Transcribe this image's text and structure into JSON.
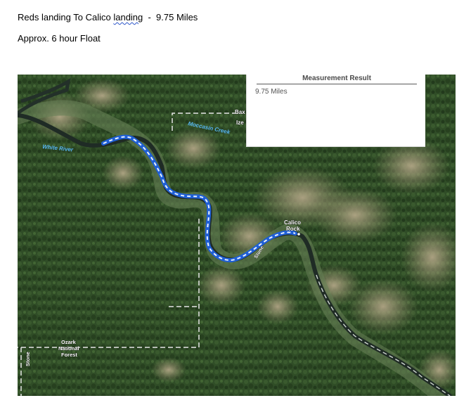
{
  "document": {
    "line1_prefix": "Reds landing To Calico ",
    "line1_misspelled": "landing",
    "line1_suffix": "  -  9.75 Miles",
    "line2": "Approx. 6 hour Float"
  },
  "measurement_panel": {
    "title": "Measurement Result",
    "value": "9.75 Miles"
  },
  "map_labels": {
    "white_river": "White River",
    "moccasin_creek": "Moccasin Creek",
    "baxter_partial": "Bax",
    "izard_partial": "Ize",
    "calico_rock_1": "Calico",
    "calico_rock_2": "Rock",
    "stone_river": "Stone",
    "ozark_1": "Ozark",
    "ozark_2": "National",
    "ozark_3": "Forest",
    "stone_county": "Stone"
  },
  "colors": {
    "measure_line": "#1f5fd6",
    "measure_dash": "#e8f2ff",
    "river": "#2b3b33",
    "county_boundary": "#e6e6e6",
    "forest": "#2f4b26"
  }
}
